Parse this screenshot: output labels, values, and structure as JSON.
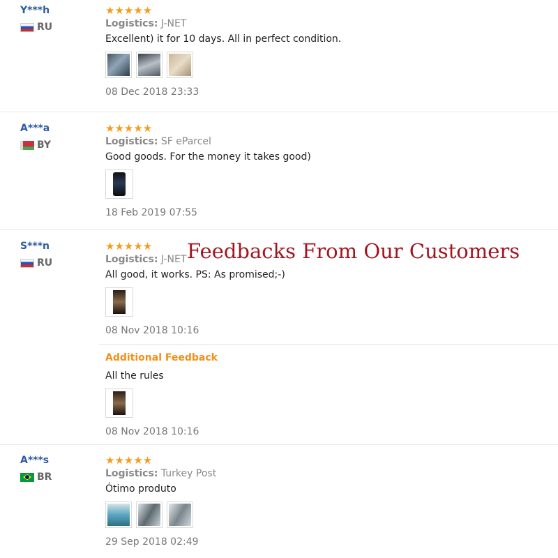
{
  "overlay_title": "Feedbacks From Our Customers",
  "logistics_label": "Logistics:",
  "star_glyphs": "★★★★★",
  "reviews": [
    {
      "user": "Y***h",
      "country": "RU",
      "flag": "flag-ru",
      "rating": 5,
      "logistics": "J-NET",
      "text": "Excellent) it for 10 days. All in perfect condition.",
      "photos": [
        "photo-1",
        "photo-2",
        "photo-3"
      ],
      "date": "08 Dec 2018 23:33"
    },
    {
      "user": "A***a",
      "country": "BY",
      "flag": "flag-by",
      "rating": 5,
      "logistics": "SF eParcel",
      "text": "Good goods. For the money it takes good)",
      "photos": [
        "photo-1"
      ],
      "date": "18 Feb 2019 07:55"
    },
    {
      "user": "S***n",
      "country": "RU",
      "flag": "flag-ru",
      "rating": 5,
      "logistics": "J-NET",
      "text": "All good, it works. PS: As promised;-)",
      "photos": [
        "photo-1"
      ],
      "date": "08 Nov 2018 10:16",
      "additional": {
        "label": "Additional Feedback",
        "text": "All the rules",
        "photos": [
          "photo-1"
        ],
        "date": "08 Nov 2018 10:16"
      }
    },
    {
      "user": "A***s",
      "country": "BR",
      "flag": "flag-br",
      "rating": 5,
      "logistics": "Turkey Post",
      "text": "Ótimo produto",
      "photos": [
        "photo-1",
        "photo-2",
        "photo-3"
      ],
      "date": "29 Sep 2018 02:49"
    }
  ]
}
